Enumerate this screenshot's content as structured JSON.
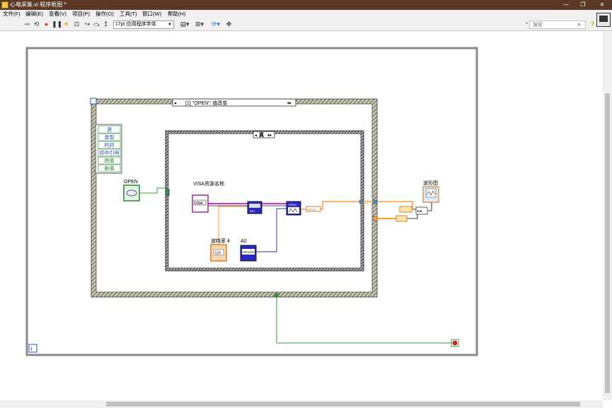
{
  "window": {
    "title": "心电采集.vi 程序框图 *",
    "min": "—",
    "restore": "❐",
    "close": "✕"
  },
  "menu": [
    "文件(F)",
    "编辑(E)",
    "查看(V)",
    "项目(P)",
    "操作(O)",
    "工具(T)",
    "窗口(W)",
    "帮助(H)"
  ],
  "toolbar": {
    "font_select": "17pt 应用程序字体",
    "search_placeholder": "搜索",
    "search_icon": "search-icon",
    "help_icon": "?"
  },
  "diagram": {
    "event_case_selector": "[1] \"OPEN\": 值改变",
    "event_data_fields": [
      "源",
      "类型",
      "时间",
      "控件引用",
      "原值",
      "新值"
    ],
    "open_label": "OPEN",
    "case_selector": "真",
    "visa_label": "VISA资源名称",
    "visa_icon_text": "VISA",
    "init_icon_text": "INIT",
    "read_icon_text": "READ",
    "baud_label": "波特率 4",
    "baud_icon_text": "123",
    "a0_label": "A0",
    "a0_icon_text": "ANALOG",
    "waveform_label": "波形图",
    "info_icon": "i",
    "loop_info_icon": "i"
  },
  "colors": {
    "title_bar": "#5a3a26",
    "wire_pink": "#cc33cc",
    "wire_orange": "#ff9a3c",
    "wire_green": "#3a9a3a",
    "wire_blue": "#3333aa"
  }
}
